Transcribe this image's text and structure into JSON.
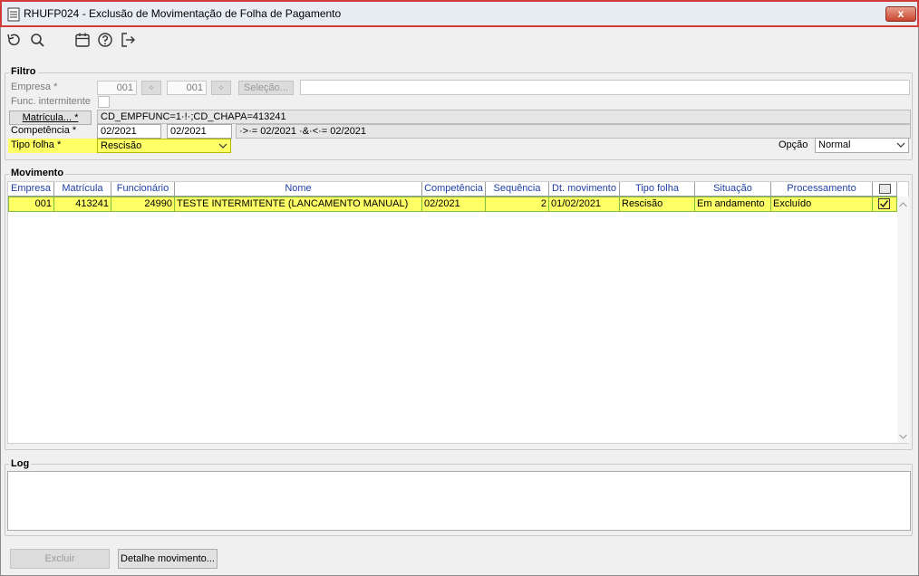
{
  "window": {
    "title": "RHUFP024 - Exclusão de Movimentação de Folha de Pagamento",
    "close_label": "x"
  },
  "toolbar": {
    "icons": [
      "refresh-icon",
      "search-icon",
      "calendar-icon",
      "help-icon",
      "exit-icon"
    ]
  },
  "filtro": {
    "group_title": "Filtro",
    "empresa_label": "Empresa *",
    "empresa_from": "001",
    "empresa_to": "001",
    "selecao_label": "Seleção...",
    "selecao_value": "",
    "func_intermitente_label": "Func. intermitente",
    "matricula_button": "Matrícula... *",
    "matricula_value": "CD_EMPFUNC=1·!·;CD_CHAPA=413241",
    "competencia_label": "Competência *",
    "competencia_from": "02/2021",
    "competencia_to": "02/2021",
    "competencia_expr": "·>·= 02/2021 ·&·<·= 02/2021",
    "tipo_folha_label": "Tipo folha *",
    "tipo_folha_value": "Rescisão",
    "opcao_label": "Opção",
    "opcao_value": "Normal"
  },
  "movimento": {
    "group_title": "Movimento",
    "columns": [
      "Empresa",
      "Matrícula",
      "Funcionário",
      "Nome",
      "Competência",
      "Sequência",
      "Dt. movimento",
      "Tipo folha",
      "Situação",
      "Processamento"
    ],
    "rows": [
      {
        "empresa": "001",
        "matricula": "413241",
        "funcionario": "24990",
        "nome": "TESTE INTERMITENTE (LANCAMENTO MANUAL)",
        "competencia": "02/2021",
        "sequencia": "2",
        "dt_movimento": "01/02/2021",
        "tipo_folha": "Rescisão",
        "situacao": "Em andamento",
        "processamento": "Excluído",
        "checked": true
      }
    ]
  },
  "log": {
    "group_title": "Log",
    "content": ""
  },
  "footer": {
    "excluir_label": "Excluir",
    "detalhe_label": "Detalhe movimento..."
  },
  "colors": {
    "highlight": "#ffff66",
    "header_text": "#1f3fa8",
    "title_border": "#d33a3a"
  }
}
